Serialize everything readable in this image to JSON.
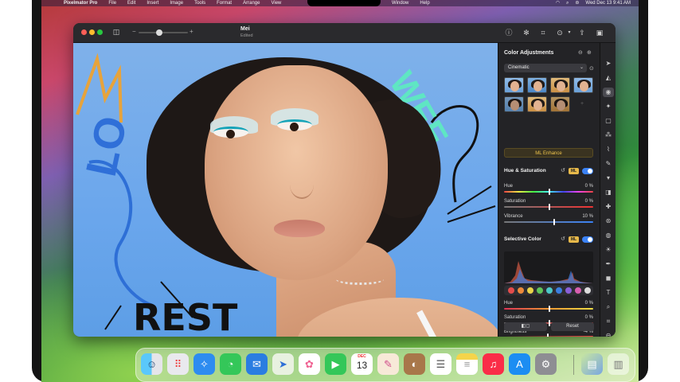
{
  "menubar": {
    "items_left": [
      "Pixelmator Pro",
      "File",
      "Edit",
      "Insert",
      "Image",
      "Tools",
      "Format",
      "Arrange",
      "View"
    ],
    "items_mid": [
      "Window",
      "Help"
    ],
    "clock": "Wed Dec 13  9:41 AM"
  },
  "document": {
    "title": "Mei",
    "subtitle": "Edited"
  },
  "panel": {
    "title": "Color Adjustments",
    "preset_dropdown": "Cinematic",
    "ml_enhance": "ML Enhance",
    "hue_saturation": {
      "title": "Hue & Saturation",
      "ml_badge": "ML",
      "rows": [
        {
          "label": "Hue",
          "value": "0 %",
          "pos": 0.5
        },
        {
          "label": "Saturation",
          "value": "0 %",
          "pos": 0.5
        },
        {
          "label": "Vibrance",
          "value": "10 %",
          "pos": 0.55
        }
      ]
    },
    "selective_color": {
      "title": "Selective Color",
      "ml_badge": "ML",
      "rows": [
        {
          "label": "Hue",
          "value": "0 %",
          "pos": 0.5
        },
        {
          "label": "Saturation",
          "value": "0 %",
          "pos": 0.5
        },
        {
          "label": "Brightness",
          "value": "-4 %",
          "pos": 0.48
        }
      ]
    },
    "reset_label": "Reset",
    "compare_label": "◧◻"
  },
  "canvas": {
    "doodle_text_bottom": "REST",
    "doodle_text_left": "LO",
    "doodle_text_right": "WEE"
  },
  "dock": {
    "calendar_month": "DEC",
    "calendar_day": "13"
  },
  "colors": {
    "accent": "#3b82f6",
    "ml_gold": "#e6b84a"
  }
}
